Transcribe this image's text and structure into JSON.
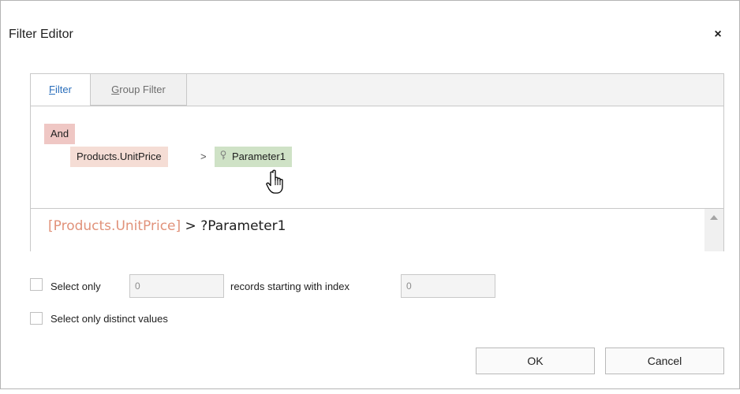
{
  "dialog": {
    "title": "Filter Editor",
    "close_glyph": "×"
  },
  "tabs": [
    {
      "label_accel": "F",
      "label_rest": "ilter"
    },
    {
      "label_accel": "G",
      "label_rest": "roup Filter"
    }
  ],
  "tree": {
    "group_operator": "And",
    "field": "Products.UnitPrice",
    "operator": ">",
    "parameter": "Parameter1",
    "parameter_icon": "parameter-key-icon"
  },
  "expression": {
    "field": "[Products.UnitPrice]",
    "rest": " > ?Parameter1"
  },
  "options": {
    "select_only_label": "Select only",
    "select_only_value": "0",
    "records_label": "records starting with index",
    "start_index_value": "0",
    "distinct_label": "Select only distinct values"
  },
  "buttons": {
    "ok": "OK",
    "cancel": "Cancel"
  },
  "colors": {
    "and_chip": "#efc7c4",
    "field_chip": "#f5ddd5",
    "param_chip": "#cfe2c6",
    "expr_field": "#e1927a",
    "active_tab_text": "#2a6ebb"
  }
}
